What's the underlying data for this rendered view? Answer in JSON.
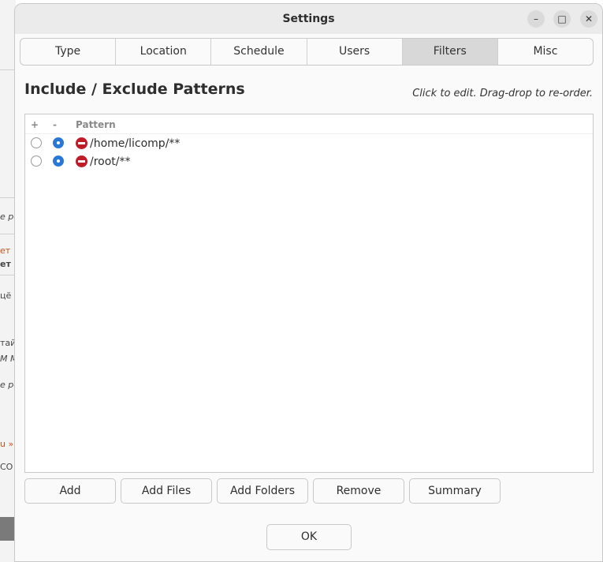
{
  "window": {
    "title": "Settings",
    "minimize_symbol": "–",
    "maximize_symbol": "□",
    "close_symbol": "✕"
  },
  "tabs": [
    {
      "label": "Type"
    },
    {
      "label": "Location"
    },
    {
      "label": "Schedule"
    },
    {
      "label": "Users"
    },
    {
      "label": "Filters",
      "active": true
    },
    {
      "label": "Misc"
    }
  ],
  "section": {
    "heading": "Include / Exclude Patterns",
    "hint": "Click to edit. Drag-drop to re-order."
  },
  "pattern_list": {
    "columns": {
      "include": "+",
      "exclude": "-",
      "pattern": "Pattern"
    },
    "rows": [
      {
        "pattern": "/home/licomp/**",
        "mode": "exclude",
        "icon": "minus-circle-icon"
      },
      {
        "pattern": "/root/**",
        "mode": "exclude",
        "icon": "minus-circle-icon"
      }
    ]
  },
  "buttons": {
    "add": "Add",
    "add_files": "Add Files",
    "add_folders": "Add Folders",
    "remove": "Remove",
    "summary": "Summary",
    "ok": "OK"
  },
  "background_fragments": [
    "е ре",
    "ет",
    "ет г",
    "цё",
    "тай",
    "М М",
    "е ре",
    "u »",
    "CO"
  ],
  "colors": {
    "accent": "#2a78d6",
    "exclude": "#c01c28",
    "active_tab": "#d8d8d8"
  }
}
